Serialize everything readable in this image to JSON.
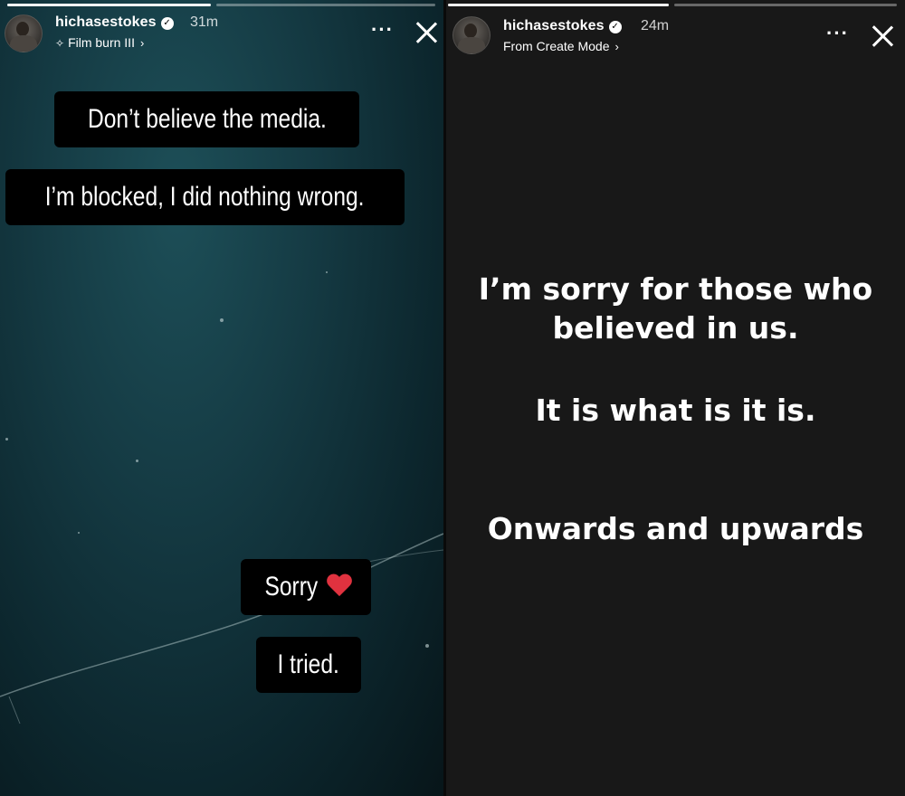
{
  "left_story": {
    "username": "hichasestokes",
    "time": "31m",
    "subtitle": "Film burn III",
    "sparkle_icon": "sparkle-icon",
    "background_color": "#153b44",
    "messages": {
      "m1": "Don’t believe the media.",
      "m2": "I’m blocked, I did nothing wrong.",
      "m3": "Sorry",
      "m4": "I tried."
    }
  },
  "right_story": {
    "username": "hichasestokes",
    "time": "24m",
    "subtitle": "From Create Mode",
    "background_color": "#181818",
    "lines": {
      "l1": "I’m sorry for those who",
      "l2": "believed in us.",
      "l3": "It is what is it is.",
      "l4": "Onwards and upwards"
    }
  },
  "icons": {
    "more": "more-options-icon",
    "close": "close-icon",
    "verified": "verified-badge-icon",
    "heart": "red-heart-emoji"
  },
  "more_label": "···",
  "chevron": "›",
  "check": "✓"
}
